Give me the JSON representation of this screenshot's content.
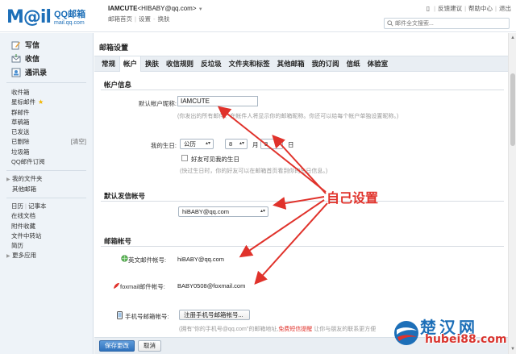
{
  "header": {
    "logo_text": "M@il",
    "logo_cn": "QQ邮箱",
    "logo_en": "mail.qq.com",
    "nickname": "IAMCUTE",
    "email": "<HIBABY@qq.com>",
    "links": [
      "邮箱首页",
      "设置",
      "换肤"
    ],
    "top_links": [
      "反馈建议",
      "帮助中心",
      "退出"
    ],
    "search_placeholder": "邮件全文搜索..."
  },
  "sidebar": {
    "main_items": [
      {
        "label": "写信",
        "icon": "compose-icon"
      },
      {
        "label": "收信",
        "icon": "inbox-icon"
      },
      {
        "label": "通讯录",
        "icon": "contacts-icon"
      }
    ],
    "folders": [
      "收件箱",
      "星标邮件",
      "群邮件",
      "草稿箱",
      "已发送",
      "已删除",
      "垃圾箱",
      "QQ邮件订阅"
    ],
    "clear_label": "[清空]",
    "my_folders": [
      "我的文件夹",
      "其他邮箱"
    ],
    "apps": [
      "日历",
      "记事本",
      "在线文档",
      "附件收藏",
      "文件中转站",
      "简历",
      "更多应用"
    ]
  },
  "main": {
    "title": "邮箱设置",
    "tabs": [
      "常规",
      "帐户",
      "换肤",
      "收信规则",
      "反垃圾",
      "文件夹和标签",
      "其他邮箱",
      "我的订阅",
      "信纸",
      "体验室"
    ],
    "active_tab": "帐户",
    "account_section": {
      "title": "帐户信息",
      "nickname_label": "默认帐户昵称:",
      "nickname_value": "IAMCUTE",
      "nickname_hint": "(你发出的所有邮件、在帐件人将显示你的邮箱昵称。你还可以给每个帐户单独设置昵称。)",
      "birthday_label": "我的生日:",
      "calendar_type": "公历",
      "month": "8",
      "month_unit": "月",
      "day": "8",
      "day_unit": "日",
      "checkbox_label": "好友可见我的生日",
      "birthday_hint": "(快过生日时，你的好友可以在邮箱首页看到你的生日信息。)"
    },
    "default_sender": {
      "title": "默认发信帐号",
      "value": "hiBABY@qq.com"
    },
    "mail_accounts": {
      "title": "邮箱帐号",
      "english_label": "英文邮件帐号:",
      "english_value": "hiBABY@qq.com",
      "foxmail_label": "foxmail邮件帐号:",
      "foxmail_value": "BABY0508@foxmail.com",
      "phone_label": "手机号邮箱帐号:",
      "phone_button": "注册手机号邮箱帐号...",
      "phone_hint_pre": "(拥有\"你的手机号@qq.com\"的邮箱地址,",
      "phone_hint_red": "免费短信提醒",
      "phone_hint_post": " 让你与朋友的联系更方便"
    },
    "annotation": "自己设置"
  },
  "footer": {
    "save_label": "保存更改",
    "cancel_label": "取消"
  },
  "watermark": {
    "cn": "楚汉网",
    "en": "hubei88.com"
  },
  "colors": {
    "accent": "#1d6fb8",
    "annotation": "#e0322b",
    "save_button": "#2f72bd"
  }
}
